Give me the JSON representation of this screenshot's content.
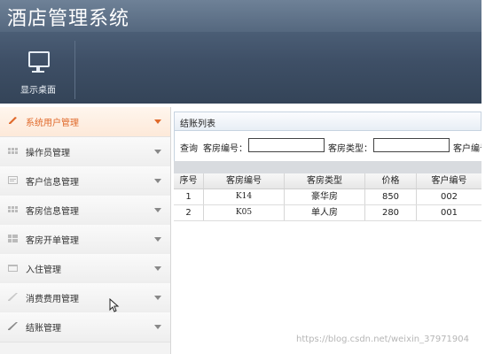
{
  "app": {
    "title": "酒店管理系统"
  },
  "toolbar": {
    "desktop_label": "显示桌面"
  },
  "sidebar": {
    "items": [
      {
        "label": "系统用户管理",
        "icon": "pencil-icon",
        "active": true
      },
      {
        "label": "操作员管理",
        "icon": "grid-icon",
        "active": false
      },
      {
        "label": "客户信息管理",
        "icon": "card-icon",
        "active": false
      },
      {
        "label": "客房信息管理",
        "icon": "grid-icon",
        "active": false
      },
      {
        "label": "客房开单管理",
        "icon": "table-icon",
        "active": false
      },
      {
        "label": "入住管理",
        "icon": "calendar-icon",
        "active": false
      },
      {
        "label": "消费费用管理",
        "icon": "pen-icon",
        "active": false
      },
      {
        "label": "结账管理",
        "icon": "pen-icon",
        "active": false
      }
    ]
  },
  "panel": {
    "title": "结账列表",
    "search": {
      "query_label": "查询",
      "room_no_label": "客房编号：",
      "room_type_label": "客房类型：",
      "customer_no_label": "客户编号"
    },
    "table": {
      "headers": [
        "序号",
        "客房编号",
        "客房类型",
        "价格",
        "客户编号"
      ],
      "rows": [
        [
          "1",
          "K14",
          "豪华房",
          "850",
          "002"
        ],
        [
          "2",
          "K05",
          "单人房",
          "280",
          "001"
        ]
      ]
    }
  },
  "watermark": "https://blog.csdn.net/weixin_37971904",
  "colors": {
    "accent": "#e0692a",
    "header": "#3e4f66"
  }
}
